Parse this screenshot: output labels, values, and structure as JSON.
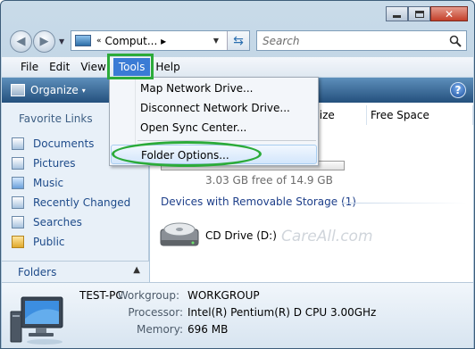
{
  "address": {
    "prefix": "«",
    "path": "Comput...",
    "arrow": "▸"
  },
  "search": {
    "placeholder": "Search"
  },
  "menubar": [
    "File",
    "Edit",
    "View",
    "Tools",
    "Help"
  ],
  "command_bar": {
    "organize": "Organize",
    "organize_arrow": "▾",
    "help": "?"
  },
  "nav_pane": {
    "header": "Favorite Links",
    "items": [
      {
        "label": "Documents",
        "icon": "documents-icon"
      },
      {
        "label": "Pictures",
        "icon": "pictures-icon"
      },
      {
        "label": "Music",
        "icon": "music-icon"
      },
      {
        "label": "Recently Changed",
        "icon": "recently-changed-icon"
      },
      {
        "label": "Searches",
        "icon": "searches-icon"
      },
      {
        "label": "Public",
        "icon": "public-folder-icon"
      }
    ],
    "folders_label": "Folders",
    "folders_chevron": "▲"
  },
  "columns": {
    "total_size": "l Size",
    "free_space": "Free Space"
  },
  "drive": {
    "free_text": "3.03 GB free of 14.9 GB",
    "used_fraction": 0.8
  },
  "removable_group": {
    "header": "Devices with Removable Storage (1)",
    "cd_label": "CD Drive (D:)"
  },
  "watermark": "CareAll.com",
  "tools_menu": {
    "items": [
      "Map Network Drive...",
      "Disconnect Network Drive...",
      "Open Sync Center...",
      "Folder Options..."
    ]
  },
  "details": {
    "pc_name": "TEST-PC",
    "workgroup_label": "Workgroup:",
    "workgroup_value": "WORKGROUP",
    "processor_label": "Processor:",
    "processor_value": "Intel(R) Pentium(R) D CPU 3.00GHz",
    "memory_label": "Memory:",
    "memory_value": "696 MB"
  },
  "colors": {
    "highlight_green": "#2cab3a",
    "menu_active": "#3a7bd5",
    "link_blue": "#1e4b8a"
  }
}
